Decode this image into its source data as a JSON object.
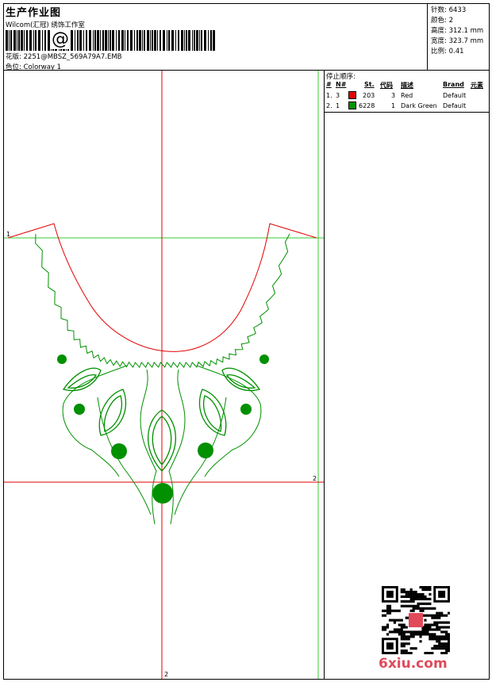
{
  "header": {
    "title": "生产作业图",
    "company": "Wilcom(汇冠) 绣饰工作室",
    "barcode_text": "@",
    "design_line": "花版: 2251@MBSZ_569A79A7.EMB",
    "colorway_line": "色位: Colorway 1"
  },
  "stats": [
    {
      "label": "针数",
      "value": "6433"
    },
    {
      "label": "颜色",
      "value": "2"
    },
    {
      "label": "高度",
      "value": "312.1 mm"
    },
    {
      "label": "宽度",
      "value": "323.7 mm"
    },
    {
      "label": "比例",
      "value": "0.41"
    }
  ],
  "stop_sequence": {
    "title": "停止顺序:",
    "columns": [
      "#",
      "N#",
      "St.",
      "代码",
      "描述",
      "Brand",
      "元素"
    ],
    "rows": [
      {
        "seq": "1.",
        "n": "3",
        "color": "#e00000",
        "stitches": "203",
        "code": "3",
        "desc": "Red",
        "brand": "Default"
      },
      {
        "seq": "2.",
        "n": "1",
        "color": "#009000",
        "stitches": "6228",
        "code": "1",
        "desc": "Dark Green",
        "brand": "Default"
      }
    ]
  },
  "ref_labels": {
    "green_h": "1",
    "red_h": "2",
    "red_v": "2"
  },
  "watermark": "6xiu.com",
  "colors": {
    "red": "#e00000",
    "green": "#009000",
    "guide_green": "#33cc33",
    "guide_red": "#e00000"
  }
}
